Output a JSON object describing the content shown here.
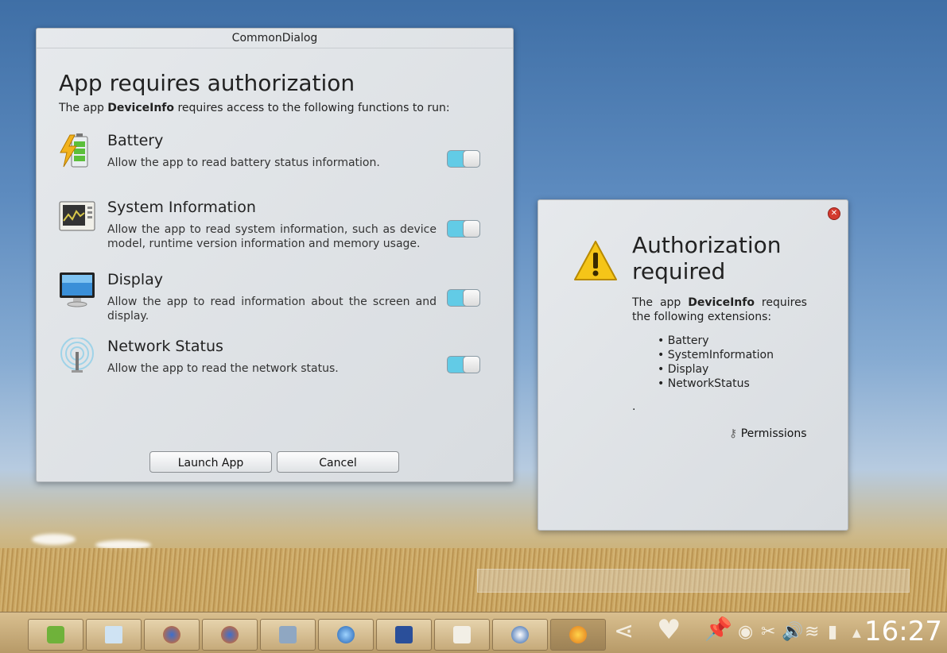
{
  "main_dialog": {
    "window_title": "CommonDialog",
    "title": "App requires authorization",
    "subtitle_prefix": "The app ",
    "app_name": "DeviceInfo",
    "subtitle_suffix": " requires access to the following functions to run:",
    "permissions": [
      {
        "icon": "battery-icon",
        "title": "Battery",
        "description": "Allow the app to read battery status information.",
        "enabled": true
      },
      {
        "icon": "system-information-icon",
        "title": "System Information",
        "description": "Allow the app to read system information, such as device model, runtime version information and memory usage.",
        "enabled": true
      },
      {
        "icon": "display-icon",
        "title": "Display",
        "description": "Allow the app to read information about the screen and display.",
        "enabled": true
      },
      {
        "icon": "network-status-icon",
        "title": "Network Status",
        "description": "Allow the app to read the network status.",
        "enabled": true
      }
    ],
    "launch_label": "Launch App",
    "cancel_label": "Cancel"
  },
  "auth_dialog": {
    "title": "Authorization required",
    "text_prefix": "The app ",
    "app_name": "DeviceInfo",
    "text_suffix": " requires the following extensions:",
    "extensions": [
      "Battery",
      "SystemInformation",
      "Display",
      "NetworkStatus"
    ],
    "trailing": ".",
    "permissions_label": "Permissions"
  },
  "taskbar": {
    "clock": "16:27",
    "tasks": [
      "qt-creator-icon",
      "notes-icon",
      "firefox-icon",
      "firefox-icon",
      "file-manager-icon",
      "browser-icon",
      "bold-app-icon",
      "home-icon",
      "web-icon",
      "fennec-icon"
    ],
    "active_task_index": 9
  },
  "colors": {
    "toggle_on": "#62cbe6",
    "warning": "#f5c518",
    "close": "#d43a2f"
  }
}
